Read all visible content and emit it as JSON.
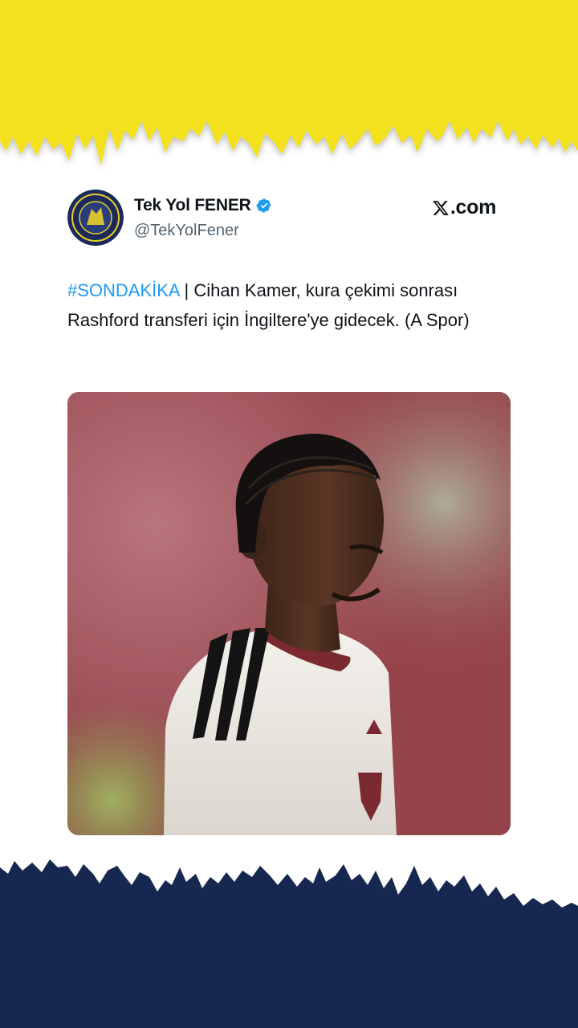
{
  "tweet": {
    "display_name": "Tek Yol FENER",
    "handle": "@TekYolFener",
    "verified_icon": "verified-badge-icon",
    "brand": "X.com",
    "hashtag": "#SONDAKİKA",
    "body_text": " | Cihan Kamer, kura çekimi sonrası Rashford transferi için İngiltere'ye gidecek. (A Spor)",
    "image_description_icon": "photo"
  },
  "colors": {
    "top_band": "#f2e11b",
    "bottom_band": "#172850",
    "hashtag": "#1d9bf0",
    "verified": "#1d9bf0",
    "text": "#0f1419",
    "handle": "#536471"
  }
}
